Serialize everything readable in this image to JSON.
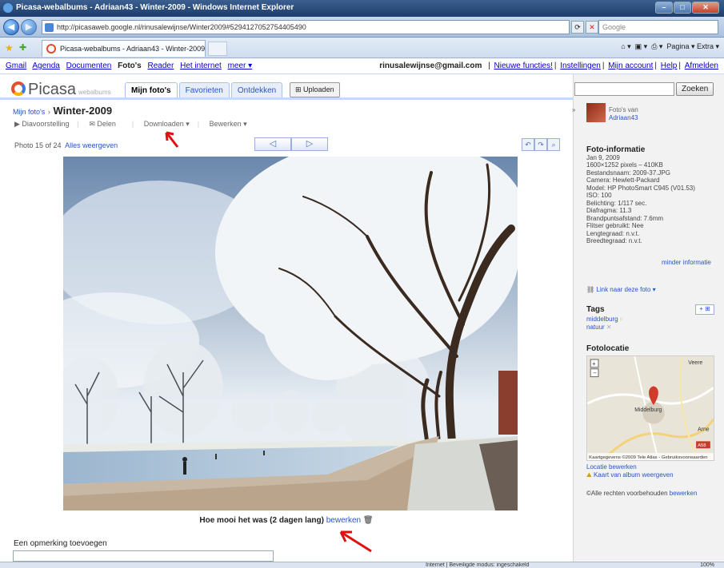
{
  "window": {
    "title": "Picasa-webalbums - Adriaan43 - Winter-2009 - Windows Internet Explorer"
  },
  "address": {
    "url": "http://picasaweb.google.nl/rinusalewijnse/Winter2009#5294127052754405490",
    "search_placeholder": "Google"
  },
  "ie_tab": {
    "label": "Picasa-webalbums - Adriaan43 - Winter-2009",
    "tools": "Pagina ▾  Extra ▾"
  },
  "gbar": {
    "links": [
      "Gmail",
      "Agenda",
      "Documenten"
    ],
    "current": "Foto's",
    "links2": [
      "Reader",
      "Het internet",
      "meer ▾"
    ],
    "email": "rinusalewijnse@gmail.com",
    "right_links": [
      "Nieuwe functies!",
      "Instellingen",
      "Mijn account",
      "Help",
      "Afmelden"
    ]
  },
  "picasa": {
    "logo": "Picasa",
    "logo_sub": "webalbums",
    "tabs": [
      "Mijn foto's",
      "Favorieten",
      "Ontdekken"
    ],
    "upload": "Uploaden"
  },
  "album": {
    "crumb_link": "Mijn foto's",
    "crumb_sep": "›",
    "title": "Winter-2009",
    "actions": [
      "▶ Diavoorstelling",
      "Delen",
      "Downloaden ▾",
      "Bewerken ▾"
    ],
    "photo_counter": "Photo 15 of 24",
    "show_all": "Alles weergeven",
    "prev": "◁",
    "next": "▷",
    "caption": "Hoe mooi het was (2 dagen lang)",
    "caption_edit": "bewerken",
    "add_comment": "Een opmerking toevoegen"
  },
  "sidebar": {
    "search_button": "Zoeken",
    "owner_label": "Foto's van",
    "owner_name": "Adriaan43",
    "info_title": "Foto-informatie",
    "info_lines": [
      "Jan 9, 2009",
      "1600×1252 pixels – 410KB",
      "Bestandsnaam: 2009-37.JPG",
      "Camera: Hewlett-Packard",
      "Model: HP PhotoSmart C945 (V01.53)",
      "ISO: 100",
      "Belichting: 1/117 sec.",
      "Diafragma: 11.3",
      "Brandpuntsafstand: 7.6mm",
      "Flitser gebruikt: Nee",
      "Lengtegraad: n.v.t.",
      "Breedtegraad: n.v.t."
    ],
    "less_info": "minder informatie",
    "link_photo": "Link naar deze foto ▾",
    "tags_title": "Tags",
    "tag_add": "+ ⊞",
    "tags": [
      "middelburg",
      "natuur"
    ],
    "location_title": "Fotolocatie",
    "map_labels": [
      "Veere",
      "Middelburg",
      "Arne",
      "A58"
    ],
    "map_copyright": "Kaartgegevens ©2009 Tele Atlas - Gebruiksvoorwaarden",
    "location_edit": "Locatie bewerken",
    "album_map": "Kaart van album weergeven",
    "rights": "©Alle rechten voorbehouden",
    "rights_edit": "bewerken"
  },
  "status": {
    "text": "Internet | Beveiligde modus: ingeschakeld",
    "zoom": "100%"
  }
}
